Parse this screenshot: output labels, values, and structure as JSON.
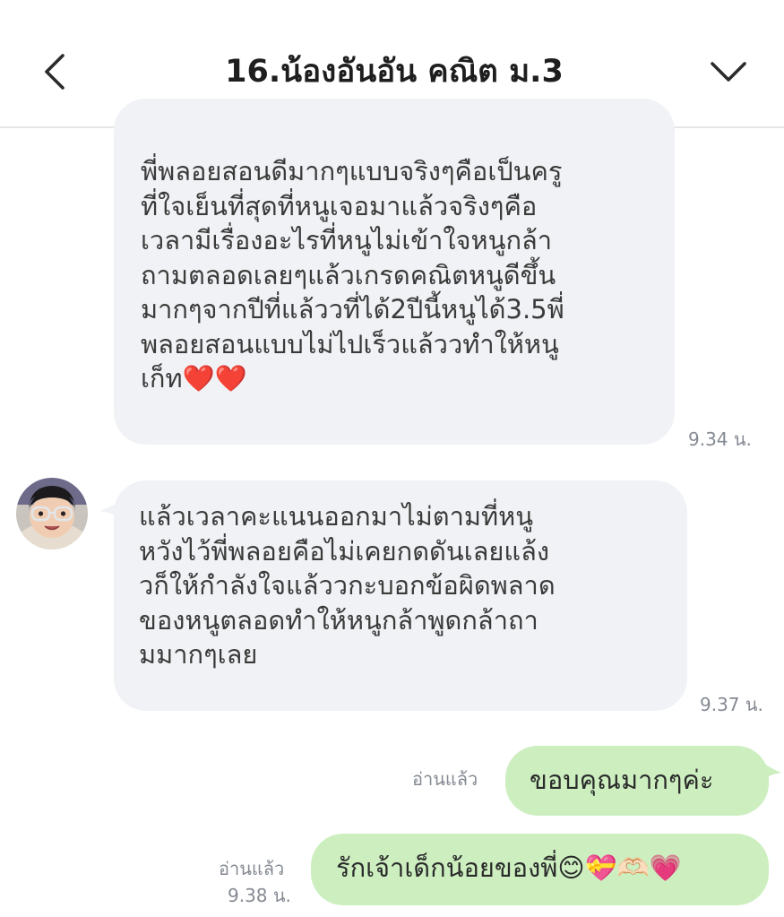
{
  "header": {
    "title": "16.น้องอันอัน คณิต ม.3",
    "back_icon": "chevron-left-icon",
    "menu_icon": "chevron-down-icon"
  },
  "colors": {
    "incoming_bubble": "#f1f2f5",
    "outgoing_bubble": "#cdefc0",
    "meta_text": "#858a93",
    "title_text": "#1e1e1e"
  },
  "messages": [
    {
      "direction": "incoming",
      "text": "พี่พลอยสอนดีมากๆแบบจริงๆคือเป็นครู\nที่ใจเย็นที่สุดที่หนูเจอมาแล้วจริงๆคือ\nเวลามีเรื่องอะไรที่หนูไม่เข้าใจหนูกล้า\nถามตลอดเลยๆแล้วเกรดคณิตหนูดีขึ้น\nมากๆจากปีที่แล้ววที่ได้2ปีนี้หนูได้3.5พี่\nพลอยสอนแบบไม่ไปเร็วแล้ววทำให้หนู\nเก็ท❤️❤️",
      "time": "9.34 น."
    },
    {
      "direction": "incoming",
      "text": "แล้วเวลาคะแนนออกมาไม่ตามที่หนู\nหวังไว้พี่พลอยคือไม่เคยกดดันเลยแล้ง\nวก็ให้กำลังใจแล้ววกะบอกข้อผิดพลาด\nของหนูตลอดทำให้หนูกล้าพูดกล้าถา\nมมากๆเลย",
      "time": "9.37 น."
    },
    {
      "direction": "outgoing",
      "text": "ขอบคุณมากๆค่ะ",
      "read": "อ่านแล้ว"
    },
    {
      "direction": "outgoing",
      "text": "รักเจ้าเด็กน้อยของพี่😊💝🫶🏻💗",
      "read": "อ่านแล้ว",
      "time": "9.38 น."
    }
  ]
}
